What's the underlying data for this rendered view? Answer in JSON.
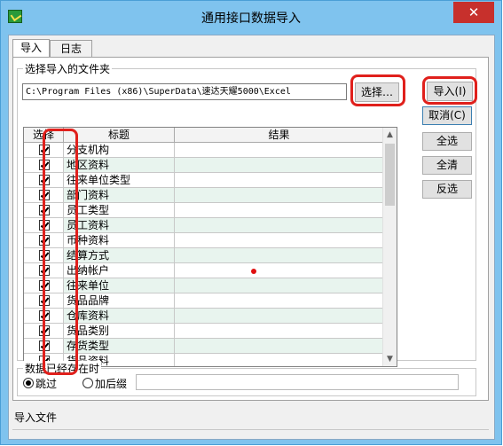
{
  "window": {
    "title": "通用接口数据导入",
    "close_label": "✕"
  },
  "tabs": [
    {
      "label": "导入",
      "active": true
    },
    {
      "label": "日志",
      "active": false
    }
  ],
  "folder_group": {
    "label": "选择导入的文件夹",
    "path_value": "C:\\Program Files (x86)\\SuperData\\速达天耀5000\\Excel",
    "choose_button": "选择…"
  },
  "actions": {
    "import": "导入(I)",
    "cancel": "取消(C)",
    "select_all": "全选",
    "clear_all": "全清",
    "invert": "反选"
  },
  "grid": {
    "columns": [
      "选择",
      "标题",
      "结果"
    ],
    "rows": [
      {
        "checked": true,
        "title": "分支机构",
        "result": ""
      },
      {
        "checked": true,
        "title": "地区资料",
        "result": ""
      },
      {
        "checked": true,
        "title": "往来单位类型",
        "result": ""
      },
      {
        "checked": true,
        "title": "部门资料",
        "result": ""
      },
      {
        "checked": true,
        "title": "员工类型",
        "result": ""
      },
      {
        "checked": true,
        "title": "员工资料",
        "result": ""
      },
      {
        "checked": true,
        "title": "币种资料",
        "result": ""
      },
      {
        "checked": true,
        "title": "结算方式",
        "result": ""
      },
      {
        "checked": true,
        "title": "出纳帐户",
        "result": ""
      },
      {
        "checked": true,
        "title": "往来单位",
        "result": ""
      },
      {
        "checked": true,
        "title": "货品品牌",
        "result": ""
      },
      {
        "checked": true,
        "title": "仓库资料",
        "result": ""
      },
      {
        "checked": true,
        "title": "货品类别",
        "result": ""
      },
      {
        "checked": true,
        "title": "存货类型",
        "result": ""
      },
      {
        "checked": true,
        "title": "货品资料",
        "result": ""
      }
    ]
  },
  "exists_group": {
    "label": "数据已经存在时",
    "option_skip": "跳过",
    "option_suffix": "加后缀",
    "selected": "skip",
    "suffix_value": ""
  },
  "status": {
    "text": "导入文件"
  },
  "colors": {
    "title_bar": "#7fc3ee",
    "close_button": "#c7302c",
    "annotation_red": "#e0201c",
    "alt_row": "#e8f4ee"
  }
}
